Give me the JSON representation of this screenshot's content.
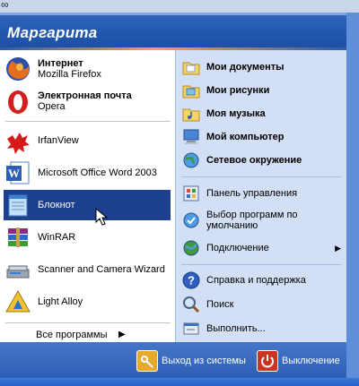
{
  "header": {
    "user_name": "Маргарита"
  },
  "pinned": [
    {
      "title": "Интернет",
      "subtitle": "Mozilla Firefox",
      "icon": "firefox-icon"
    },
    {
      "title": "Электронная почта",
      "subtitle": "Opera",
      "icon": "opera-icon"
    }
  ],
  "recent": [
    {
      "label": "IrfanView",
      "icon": "irfanview-icon"
    },
    {
      "label": "Microsoft Office Word 2003",
      "icon": "word-icon"
    },
    {
      "label": "Блокнот",
      "icon": "notepad-icon",
      "selected": true
    },
    {
      "label": "WinRAR",
      "icon": "winrar-icon"
    },
    {
      "label": "Scanner and Camera Wizard",
      "icon": "scanner-icon"
    },
    {
      "label": "Light Alloy",
      "icon": "light-alloy-icon"
    }
  ],
  "all_programs": {
    "label": "Все программы"
  },
  "places": [
    {
      "label": "Мои документы",
      "icon": "folder-documents-icon"
    },
    {
      "label": "Мои рисунки",
      "icon": "folder-pictures-icon"
    },
    {
      "label": "Моя музыка",
      "icon": "folder-music-icon"
    },
    {
      "label": "Мой компьютер",
      "icon": "computer-icon"
    },
    {
      "label": "Сетевое окружение",
      "icon": "network-icon"
    }
  ],
  "system": [
    {
      "label": "Панель управления",
      "icon": "control-panel-icon"
    },
    {
      "label": "Выбор программ по умолчанию",
      "icon": "default-programs-icon"
    },
    {
      "label": "Подключение",
      "icon": "connect-icon",
      "submenu": true
    }
  ],
  "tools": [
    {
      "label": "Справка и поддержка",
      "icon": "help-icon"
    },
    {
      "label": "Поиск",
      "icon": "search-icon"
    },
    {
      "label": "Выполнить...",
      "icon": "run-icon"
    }
  ],
  "footer": {
    "logoff": "Выход из системы",
    "shutdown": "Выключение"
  },
  "colors": {
    "header": "#2257ad",
    "selection": "#1d3f8f",
    "right_pane": "#d2dff5",
    "footer": "#3566bd"
  }
}
